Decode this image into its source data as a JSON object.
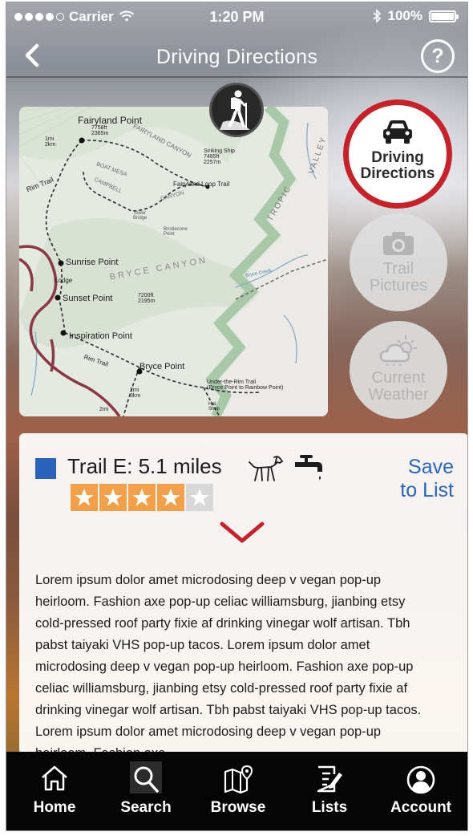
{
  "status_bar": {
    "carrier": "Carrier",
    "time": "1:20 PM",
    "battery": "100%"
  },
  "nav": {
    "title": "Driving Directions",
    "help_label": "?"
  },
  "map": {
    "labels": {
      "fairyland_point": "Fairyland Point",
      "fairyland_elev": "7758ft\n2365m",
      "one_mi": "1mi\n2km",
      "fairyland_canyon": "FAIRYLAND CANYON",
      "boat_mesa": "BOAT MESA",
      "campbell": "CAMPBELL",
      "canyon": "CANYON",
      "sinking_ship": "Sinking Ship\n7485ft\n2257m",
      "fairyland_loop": "Fairyland Loop Trail",
      "rim_trail": "Rim Trail",
      "tropic": "TROPIC",
      "valley": "VALLEY",
      "tower_bridge": "Tower\nBridge",
      "bristlecone": "Bristlecone\nPoint",
      "sunrise_point": "Sunrise Point",
      "lodge": "Lodge",
      "bryce_canyon": "BRYCE  CANYON",
      "sunset_point": "Sunset Point",
      "elev_7200": "7200ft\n2195m",
      "inspiration_point": "Inspiration Point",
      "bryce_point": "Bryce Point",
      "rim_trail_2": "Rim  Trail",
      "two_mi_a": "2mi\n3km",
      "two_mi_b": "2mi",
      "under_rim": "Under-the-Rim Trail\n(Bryce Point to Rainbow Point)",
      "hat_shop": "Hat\nShop",
      "bryce_creek": "Bryce Creek"
    }
  },
  "actions": {
    "driving": {
      "label_line1": "Driving",
      "label_line2": "Directions",
      "icon": "car-icon"
    },
    "pictures": {
      "label_line1": "Trail",
      "label_line2": "Pictures",
      "icon": "camera-icon"
    },
    "weather": {
      "label_line1": "Current",
      "label_line2": "Weather",
      "icon": "cloud-sun-icon"
    }
  },
  "trail": {
    "name": "Trail E: 5.1 miles",
    "color": "#2a63b8",
    "rating": 4,
    "rating_max": 5,
    "amenities": [
      "dog-icon",
      "water-tap-icon"
    ],
    "save_line1": "Save",
    "save_line2": "to List",
    "description": "Lorem ipsum dolor amet microdosing deep v vegan pop-up heirloom. Fashion axe pop-up celiac williamsburg, jianbing etsy cold-pressed roof party fixie af drinking vinegar wolf artisan. Tbh pabst taiyaki VHS pop-up tacos. Lorem ipsum dolor amet microdosing deep v vegan pop-up heirloom. Fashion axe pop-up celiac williamsburg, jianbing etsy cold-pressed roof party fixie af drinking vinegar wolf artisan. Tbh pabst taiyaki VHS pop-up tacos. Lorem ipsum dolor amet microdosing deep v vegan pop-up heirloom. Fashion axe"
  },
  "tabs": [
    {
      "label": "Home",
      "icon": "home-icon"
    },
    {
      "label": "Search",
      "icon": "search-icon",
      "active": true
    },
    {
      "label": "Browse",
      "icon": "map-icon"
    },
    {
      "label": "Lists",
      "icon": "list-edit-icon"
    },
    {
      "label": "Account",
      "icon": "account-icon"
    }
  ],
  "colors": {
    "accent_red": "#c6222c",
    "link_blue": "#2a63b8",
    "star_orange": "#f2a04a"
  }
}
